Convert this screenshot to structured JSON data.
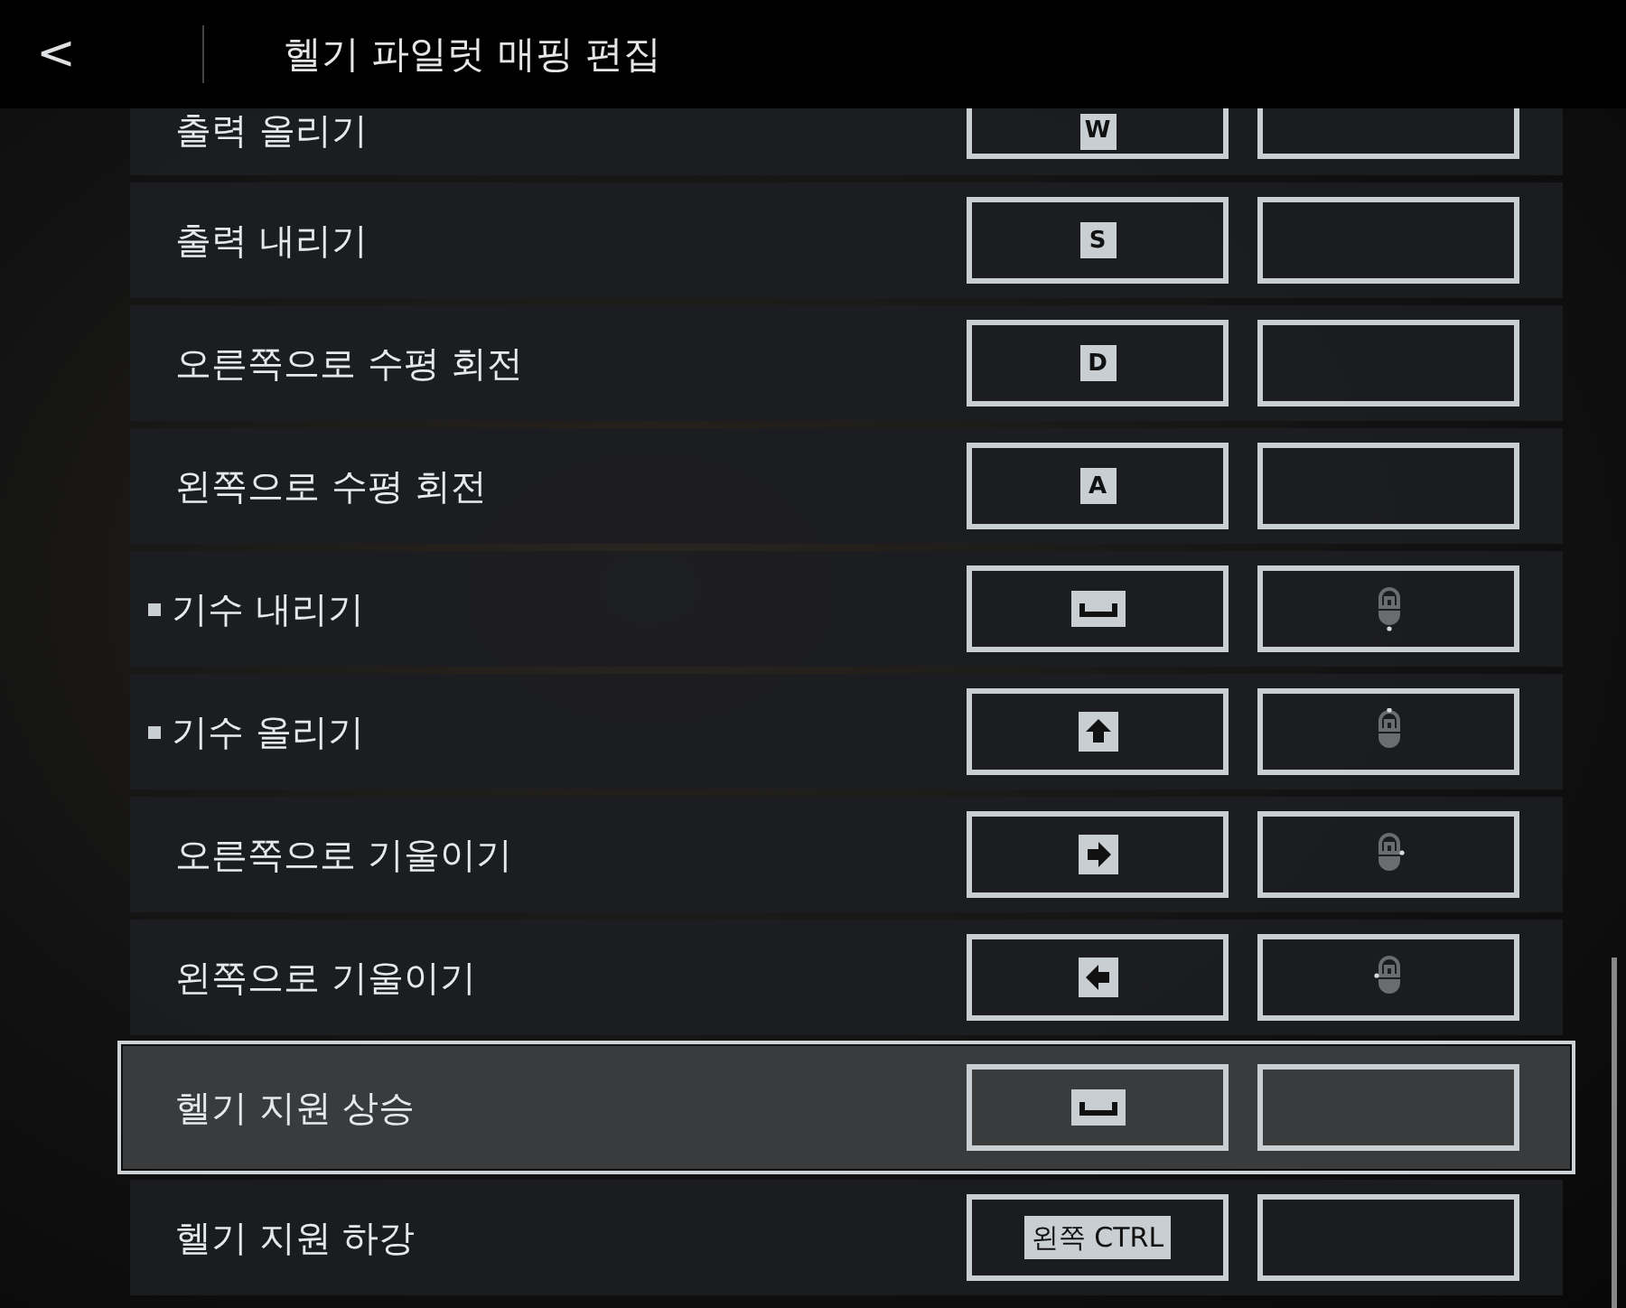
{
  "header": {
    "back": "<",
    "title": "헬기 파일럿 매핑 편집"
  },
  "rows": [
    {
      "label": "출력 올리기",
      "marked": false,
      "selected": false,
      "primary": {
        "kind": "letter",
        "text": "W"
      },
      "secondary": {
        "kind": "none"
      }
    },
    {
      "label": "출력 내리기",
      "marked": false,
      "selected": false,
      "primary": {
        "kind": "letter",
        "text": "S"
      },
      "secondary": {
        "kind": "none"
      }
    },
    {
      "label": "오른쪽으로 수평 회전",
      "marked": false,
      "selected": false,
      "primary": {
        "kind": "letter",
        "text": "D"
      },
      "secondary": {
        "kind": "none"
      }
    },
    {
      "label": "왼쪽으로 수평 회전",
      "marked": false,
      "selected": false,
      "primary": {
        "kind": "letter",
        "text": "A"
      },
      "secondary": {
        "kind": "none"
      }
    },
    {
      "label": "기수 내리기",
      "marked": true,
      "selected": false,
      "primary": {
        "kind": "space"
      },
      "secondary": {
        "kind": "wheel-down"
      }
    },
    {
      "label": "기수 올리기",
      "marked": true,
      "selected": false,
      "primary": {
        "kind": "arrow-up"
      },
      "secondary": {
        "kind": "wheel-up"
      }
    },
    {
      "label": "오른쪽으로 기울이기",
      "marked": false,
      "selected": false,
      "primary": {
        "kind": "arrow-right"
      },
      "secondary": {
        "kind": "wheel-right"
      }
    },
    {
      "label": "왼쪽으로 기울이기",
      "marked": false,
      "selected": false,
      "primary": {
        "kind": "arrow-left"
      },
      "secondary": {
        "kind": "wheel-left"
      }
    },
    {
      "label": "헬기 지원 상승",
      "marked": false,
      "selected": true,
      "primary": {
        "kind": "space"
      },
      "secondary": {
        "kind": "none"
      }
    },
    {
      "label": "헬기 지원 하강",
      "marked": false,
      "selected": false,
      "primary": {
        "kind": "label",
        "text": "왼쪽 CTRL"
      },
      "secondary": {
        "kind": "none"
      }
    }
  ]
}
